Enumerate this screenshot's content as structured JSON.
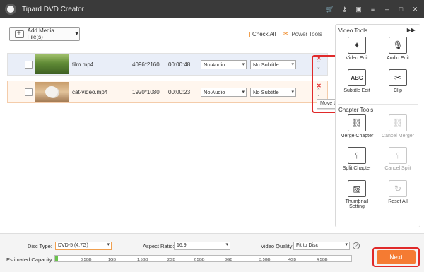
{
  "titlebar": {
    "title": "Tipard DVD Creator",
    "icons": [
      "cart-icon",
      "key-icon",
      "chat-icon",
      "menu-icon",
      "minimize-icon",
      "maximize-icon",
      "close-icon"
    ]
  },
  "toolbar": {
    "add_media_label": "Add Media File(s)",
    "check_all_label": "Check All",
    "power_tools_label": "Power Tools"
  },
  "media": [
    {
      "name": "film.mp4",
      "resolution": "4096*2160",
      "duration": "00:00:48",
      "audio": "No Audio",
      "subtitle": "No Subtitle"
    },
    {
      "name": "cat-video.mp4",
      "resolution": "1920*1080",
      "duration": "00:00:23",
      "audio": "No Audio",
      "subtitle": "No Subtitle"
    }
  ],
  "tooltip": "Move Up",
  "panel": {
    "video_tools_title": "Video Tools",
    "chapter_tools_title": "Chapter Tools",
    "video_tools": [
      {
        "label": "Video Edit",
        "icon": "magic-wand-icon",
        "enabled": true
      },
      {
        "label": "Audio Edit",
        "icon": "microphone-icon",
        "enabled": true
      },
      {
        "label": "Subtitle Edit",
        "icon": "abc-icon",
        "enabled": true
      },
      {
        "label": "Clip",
        "icon": "scissors-icon",
        "enabled": true
      }
    ],
    "chapter_tools": [
      {
        "label": "Merge Chapter",
        "icon": "link-icon",
        "enabled": true
      },
      {
        "label": "Cancel Merger",
        "icon": "unlink-icon",
        "enabled": false
      },
      {
        "label": "Split Chapter",
        "icon": "split-icon",
        "enabled": true
      },
      {
        "label": "Cancel Split",
        "icon": "cancel-split-icon",
        "enabled": false
      },
      {
        "label": "Thumbnail Setting",
        "label_line1": "Thumbnail",
        "label_line2": "Setting",
        "icon": "thumbnail-icon",
        "enabled": true
      },
      {
        "label": "Reset All",
        "icon": "reset-icon",
        "enabled": false
      }
    ]
  },
  "bottom": {
    "disc_type_label": "Disc Type:",
    "disc_type_value": "DVD-5 (4.7G)",
    "aspect_ratio_label": "Aspect Ratio:",
    "aspect_ratio_value": "16:9",
    "video_quality_label": "Video Quality:",
    "video_quality_value": "Fit to Disc",
    "capacity_label": "Estimated Capacity:",
    "capacity_ticks": [
      "0.5GB",
      "1GB",
      "1.5GB",
      "2GB",
      "2.5GB",
      "3GB",
      "3.5GB",
      "4GB",
      "4.5GB"
    ],
    "capacity_fill_fraction": 0.01,
    "next_label": "Next"
  },
  "colors": {
    "accent": "#f57b32",
    "highlight_red": "#e02a2a",
    "capacity_green": "#69c24a"
  }
}
